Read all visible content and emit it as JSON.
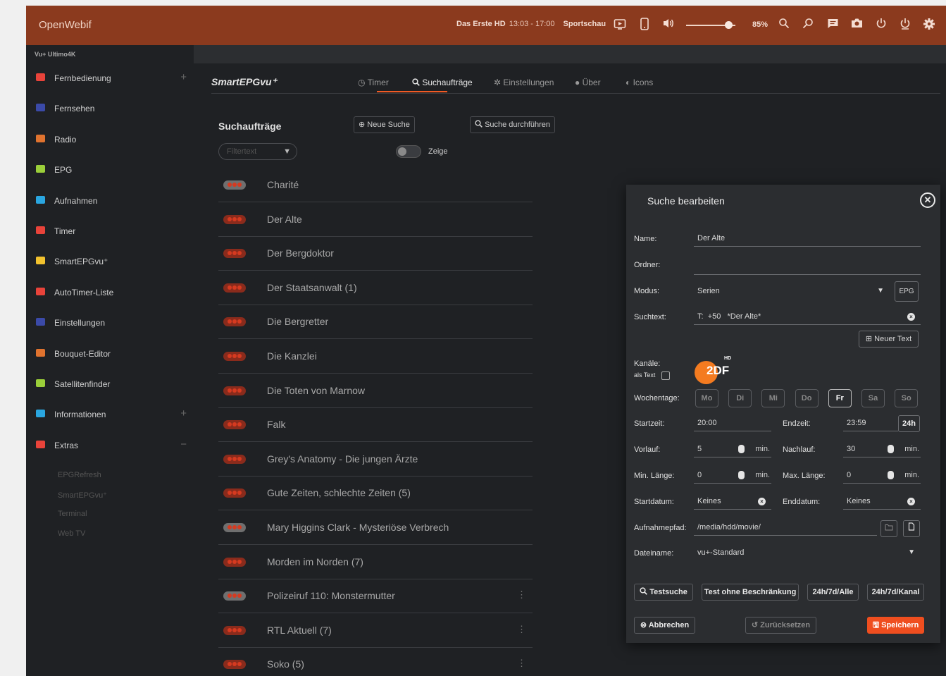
{
  "topbar": {
    "brand": "OpenWebif",
    "channel": "Das Erste HD",
    "time": "13:03 - 17:00",
    "show": "Sportschau",
    "volume": "85%",
    "volume_level": 0.85
  },
  "sidebar": {
    "device": "Vu+ Ultimo4K",
    "items": [
      {
        "label": "Fernbedienung",
        "icon": "grid-icon",
        "color": "#e8433a"
      },
      {
        "label": "Fernsehen",
        "icon": "tv-icon",
        "color": "#3b4aa8"
      },
      {
        "label": "Radio",
        "icon": "radio-icon",
        "color": "#e0732f"
      },
      {
        "label": "EPG",
        "icon": "calendar-icon",
        "color": "#9bcf3a"
      },
      {
        "label": "Aufnahmen",
        "icon": "clapper-icon",
        "color": "#2aa6e0"
      },
      {
        "label": "Timer",
        "icon": "clock-icon",
        "color": "#e8433a"
      },
      {
        "label": "SmartEPGvu⁺",
        "icon": "list-icon",
        "color": "#f2c22e"
      },
      {
        "label": "AutoTimer-Liste",
        "icon": "timer-icon",
        "color": "#e8433a"
      },
      {
        "label": "Einstellungen",
        "icon": "gear-icon",
        "color": "#3b4aa8"
      },
      {
        "label": "Bouquet-Editor",
        "icon": "list-icon",
        "color": "#e0732f"
      },
      {
        "label": "Satellitenfinder",
        "icon": "wifi-icon",
        "color": "#9bcf3a"
      },
      {
        "label": "Informationen",
        "icon": "info-icon",
        "color": "#2aa6e0"
      },
      {
        "label": "Extras",
        "icon": "apps-icon",
        "color": "#e8433a"
      }
    ],
    "sub_items": [
      "EPGRefresh",
      "SmartEPGvu⁺",
      "Terminal",
      "Web TV"
    ]
  },
  "main": {
    "plugin_title": "SmartEPGvu⁺",
    "tabs": [
      {
        "label": "Timer",
        "icon": "clock-icon"
      },
      {
        "label": "Suchaufträge",
        "icon": "search-icon"
      },
      {
        "label": "Einstellungen",
        "icon": "gear-icon"
      },
      {
        "label": "Über",
        "icon": "info-icon"
      },
      {
        "label": "Icons",
        "icon": "half-circle-icon"
      }
    ],
    "section_title": "Suchaufträge",
    "new_search": "Neue Suche",
    "run_search": "Suche durchführen",
    "filter_placeholder": "Filtertext",
    "toggle_label": "Zeige",
    "rows": [
      {
        "label": "Charité",
        "grey": true
      },
      {
        "label": "Der Alte",
        "grey": false
      },
      {
        "label": "Der Bergdoktor",
        "grey": false
      },
      {
        "label": "Der Staatsanwalt (1)",
        "grey": false
      },
      {
        "label": "Die Bergretter",
        "grey": false
      },
      {
        "label": "Die Kanzlei",
        "grey": false
      },
      {
        "label": "Die Toten von Marnow",
        "grey": false
      },
      {
        "label": "Falk",
        "grey": false
      },
      {
        "label": "Grey's Anatomy - Die jungen Ärzte",
        "grey": false
      },
      {
        "label": "Gute Zeiten, schlechte Zeiten (5)",
        "grey": false
      },
      {
        "label": "Mary Higgins Clark - Mysteriöse Verbrech",
        "grey": true
      },
      {
        "label": "Morden im Norden (7)",
        "grey": false
      },
      {
        "label": "Polizeiruf 110: Monstermutter",
        "grey": true
      },
      {
        "label": "RTL Aktuell (7)",
        "grey": false
      },
      {
        "label": "Soko (5)",
        "grey": false
      }
    ]
  },
  "modal": {
    "title": "Suche bearbeiten",
    "name_label": "Name:",
    "name_value": "Der Alte",
    "folder_label": "Ordner:",
    "folder_value": "",
    "mode_label": "Modus:",
    "mode_value": "Serien",
    "epg_button": "EPG",
    "searchtext_label": "Suchtext:",
    "searchtext_prefix": "T:",
    "searchtext_num": "+50",
    "searchtext_value": "*Der Alte*",
    "new_text_button": "Neuer Text",
    "channels_label": "Kanäle:",
    "as_text_label": "als Text",
    "zdf_text": "2DF",
    "zdf_hd": "HD",
    "weekdays_label": "Wochentage:",
    "weekdays": [
      {
        "label": "Mo",
        "on": false
      },
      {
        "label": "Di",
        "on": false
      },
      {
        "label": "Mi",
        "on": false
      },
      {
        "label": "Do",
        "on": false
      },
      {
        "label": "Fr",
        "on": true
      },
      {
        "label": "Sa",
        "on": false
      },
      {
        "label": "So",
        "on": false
      }
    ],
    "start_label": "Startzeit:",
    "start_value": "20:00",
    "end_label": "Endzeit:",
    "end_value": "23:59",
    "h24_button": "24h",
    "pre_label": "Vorlauf:",
    "pre_value": "5",
    "post_label": "Nachlauf:",
    "post_value": "30",
    "min_unit": "min.",
    "minlen_label": "Min. Länge:",
    "minlen_value": "0",
    "maxlen_label": "Max. Länge:",
    "maxlen_value": "0",
    "startdate_label": "Startdatum:",
    "startdate_value": "Keines",
    "enddate_label": "Enddatum:",
    "enddate_value": "Keines",
    "path_label": "Aufnahmepfad:",
    "path_value": "/media/hdd/movie/",
    "filename_label": "Dateiname:",
    "filename_value": "vu+-Standard",
    "btn_test": "Testsuche",
    "btn_test_unrestricted": "Test ohne Beschränkung",
    "btn_24h_all": "24h/7d/Alle",
    "btn_24h_channel": "24h/7d/Kanal",
    "btn_cancel": "Abbrechen",
    "btn_reset": "Zurücksetzen",
    "btn_save": "Speichern",
    "accent_color": "#ef4e1f"
  }
}
